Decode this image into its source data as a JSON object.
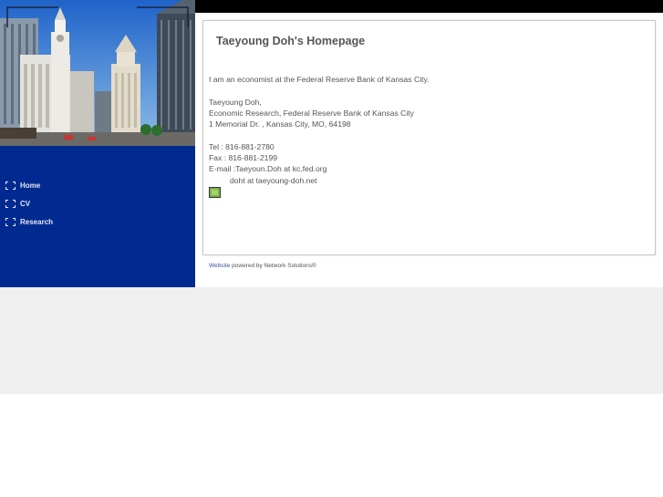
{
  "colors": {
    "sidebar": "#002a90",
    "topbar": "#000000",
    "link": "#3a56a0",
    "band": "#efefef"
  },
  "sidebar": {
    "items": [
      {
        "label": "Home",
        "icon": "expand-corners-icon"
      },
      {
        "label": "CV",
        "icon": "expand-corners-icon"
      },
      {
        "label": "Research",
        "icon": "expand-corners-icon"
      }
    ]
  },
  "main": {
    "title": "Taeyoung Doh's Homepage",
    "intro": "I am an economist at the Federal Reserve Bank of Kansas City.",
    "name": "Taeyoung Doh,",
    "department": "Economic Research, Federal Reserve Bank of Kansas City",
    "address": "1 Memorial Dr. , Kansas City, MO, 64198",
    "tel": "Tel : 816-881-2780",
    "fax": "Fax : 816-881-2199",
    "email1": "E-mail :Taeyoun.Doh at kc.fed.org",
    "email2": "doht at taeyoung-doh.net",
    "image_icon": "broken-image-icon"
  },
  "footer": {
    "link_text": "Website",
    "text": " powered by Network Solutions®"
  }
}
